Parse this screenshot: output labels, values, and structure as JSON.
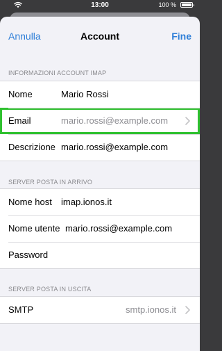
{
  "status_bar": {
    "time": "13:00",
    "battery_text": "100 %",
    "battery_level": 1.0,
    "wifi_icon": "wifi-icon",
    "battery_icon": "battery-icon"
  },
  "nav": {
    "left_label": "Annulla",
    "title": "Account",
    "right_label": "Fine",
    "accent_color": "#2f7fd8"
  },
  "sections": {
    "imap": {
      "header": "INFORMAZIONI ACCOUNT IMAP",
      "rows": [
        {
          "label": "Nome",
          "value": "Mario Rossi"
        },
        {
          "label": "Email",
          "value": "mario.rossi@example.com",
          "chevron_icon": "chevron-right-icon",
          "highlighted": true,
          "highlight_color": "#2fc12f"
        },
        {
          "label": "Descrizione",
          "value": "mario.rossi@example.com"
        }
      ]
    },
    "incoming": {
      "header": "SERVER POSTA IN ARRIVO",
      "rows": [
        {
          "label": "Nome host",
          "value": "imap.ionos.it"
        },
        {
          "label": "Nome utente",
          "value": "mario.rossi@example.com"
        },
        {
          "label": "Password",
          "value": ""
        }
      ]
    },
    "outgoing": {
      "header": "SERVER POSTA IN USCITA",
      "rows": [
        {
          "label": "SMTP",
          "value": "smtp.ionos.it",
          "chevron_icon": "chevron-right-icon"
        }
      ]
    }
  }
}
